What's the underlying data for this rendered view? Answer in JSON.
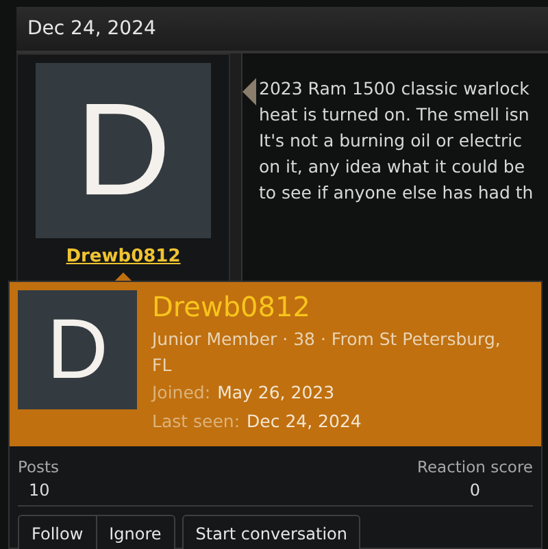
{
  "post_date": "Dec 24, 2024",
  "author": {
    "name": "Drewb0812",
    "avatar_letter": "D"
  },
  "post_lines": [
    "2023 Ram 1500 classic warlock",
    "heat is turned on. The smell isn",
    "It's not a burning oil or electric",
    "on it, any idea what it could be",
    "to see if anyone else has had th"
  ],
  "popup": {
    "avatar_letter": "D",
    "name": "Drewb0812",
    "info": "Junior Member · 38 · From St Petersburg, FL",
    "joined_label": "Joined:",
    "joined": "May 26, 2023",
    "last_seen_label": "Last seen:",
    "last_seen": "Dec 24, 2024",
    "stats": [
      {
        "label": "Posts",
        "value": "10"
      },
      {
        "label": "Reaction score",
        "value": "0"
      }
    ],
    "buttons": [
      "Follow",
      "Ignore",
      "Start conversation"
    ]
  }
}
